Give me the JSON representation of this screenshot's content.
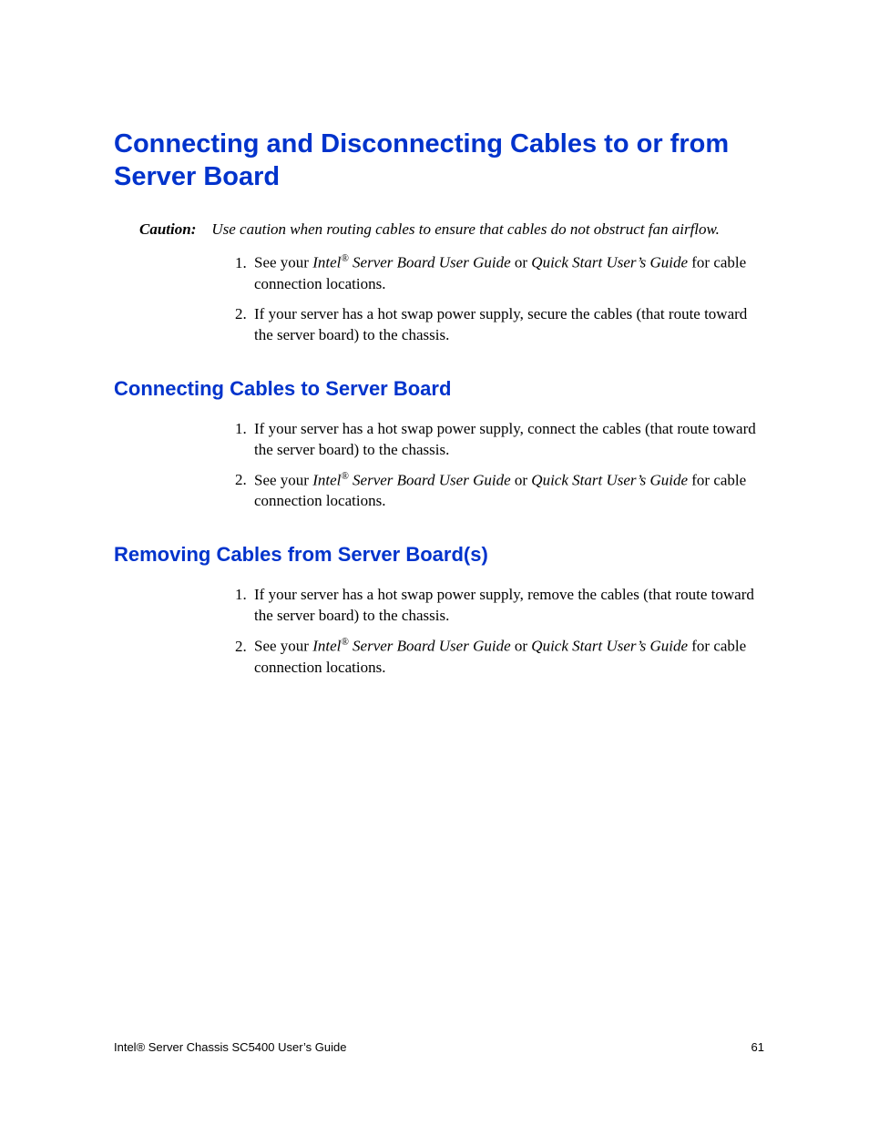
{
  "heading1": "Connecting and Disconnecting Cables to or from Server Board",
  "caution": {
    "label": "Caution:",
    "text": "Use caution when routing cables to ensure that cables do not obstruct fan airflow."
  },
  "intro_list": {
    "item1": {
      "a": "See your ",
      "brand": "Intel",
      "sup": "®",
      "guide1": " Server Board User Guide",
      "b": " or ",
      "guide2": "Quick Start User’s Guide",
      "c": " for cable connection locations."
    },
    "item2": "If your server has a hot swap power supply, secure the cables (that route toward the server board) to the chassis."
  },
  "section_connect": {
    "heading": "Connecting Cables to Server Board",
    "item1": "If your server has a hot swap power supply, connect the cables (that route toward the server board) to the chassis.",
    "item2": {
      "a": "See your ",
      "brand": "Intel",
      "sup": "®",
      "guide1": " Server Board User Guide",
      "b": " or ",
      "guide2": "Quick Start User’s Guide",
      "c": " for cable connection locations."
    }
  },
  "section_remove": {
    "heading": "Removing Cables from Server Board(s)",
    "item1": "If your server has a hot swap power supply, remove the cables (that route toward the server board) to the chassis.",
    "item2": {
      "a": "See your ",
      "brand": "Intel",
      "sup": "®",
      "guide1": " Server Board User Guide",
      "b": " or ",
      "guide2": "Quick Start User’s Guide",
      "c": " for cable connection locations."
    }
  },
  "footer": {
    "left": "Intel® Server Chassis SC5400 User’s Guide",
    "right": "61"
  }
}
